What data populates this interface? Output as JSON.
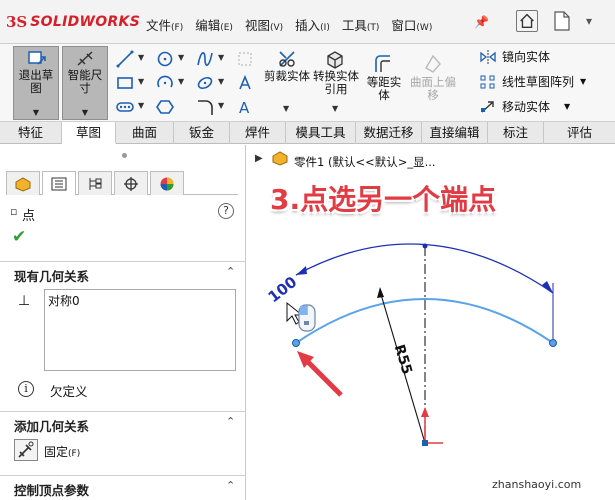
{
  "app": {
    "logo_ds": "3S",
    "logo_name": "SOLIDWORKS"
  },
  "menu": [
    {
      "label": "文件",
      "key": "(F)"
    },
    {
      "label": "编辑",
      "key": "(E)"
    },
    {
      "label": "视图",
      "key": "(V)"
    },
    {
      "label": "插入",
      "key": "(I)"
    },
    {
      "label": "工具",
      "key": "(T)"
    },
    {
      "label": "窗口",
      "key": "(W)"
    }
  ],
  "ribbon": {
    "exit_sketch": "退出草图",
    "smart_dim": "智能尺寸",
    "trim": "剪裁实体",
    "convert": "转换实体引用",
    "offset": "等距实体",
    "surface_offset": "曲面上偏移",
    "mirror": "镜向实体",
    "linear_pattern": "线性草图阵列",
    "move": "移动实体"
  },
  "tabs": [
    "特征",
    "草图",
    "曲面",
    "钣金",
    "焊件",
    "模具工具",
    "数据迁移",
    "直接编辑",
    "标注",
    "评估"
  ],
  "active_tab": "草图",
  "panel": {
    "title": "点",
    "existing_relations_header": "现有几何关系",
    "relations": [
      "对称0"
    ],
    "status": "欠定义",
    "add_relations_header": "添加几何关系",
    "fix_label": "固定",
    "fix_key": "(F)",
    "control_header": "控制顶点参数"
  },
  "canvas": {
    "tree_text": "零件1 (默认<<默认>_显...",
    "step_text": "3.点选另一个端点",
    "dim_angle": "100",
    "dim_radius": "R55",
    "watermark": "zhanshaoyi.com"
  },
  "colors": {
    "accent_red": "#e23b43",
    "sketch_blue": "#5aa3e8",
    "dim_blue": "#1e2fb5"
  }
}
